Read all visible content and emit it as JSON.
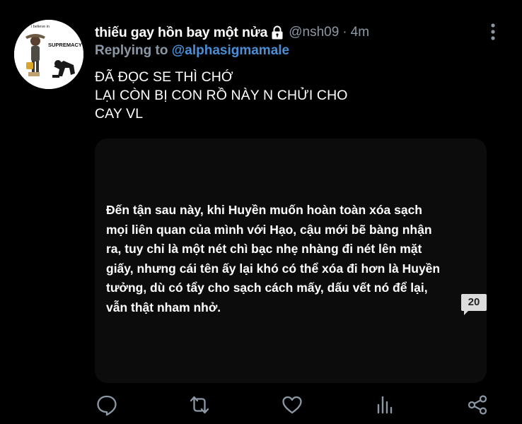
{
  "tweet": {
    "display_name": "thiếu gay hồn bay một nửa",
    "handle": "@nsh09",
    "separator": "·",
    "timestamp": "4m",
    "replying_prefix": "Replying to ",
    "replying_to": "@alphasigmamale",
    "text_lines": [
      "ĐÃ ĐỌC SE THÌ CHỚ",
      "LẠI CÒN BỊ CON RỒ NÀY N CHỬI CHO",
      "CAY VL"
    ]
  },
  "avatar": {
    "caption_small": "i believe in",
    "caption_big": "SUPREMACY"
  },
  "media": {
    "lines": [
      "Đến tận sau này, khi Huyền muốn hoàn toàn xóa sạch",
      "mọi liên quan của mình với Hạo, cậu mới bẽ bàng nhận",
      "ra, tuy chỉ là một nét chì bạc nhẹ nhàng đi nét lên mặt",
      "giấy, nhưng cái tên ấy lại khó có thể xóa đi hơn là Huyền",
      "tưởng, dù có tẩy cho sạch cách mấy, dấu vết nó để lại,",
      "vẫn thật nham nhở."
    ],
    "page_badge": "20"
  },
  "icons": {
    "lock": "lock-icon",
    "more": "more-vertical-icon",
    "reply": "reply-icon",
    "retweet": "retweet-icon",
    "like": "heart-icon",
    "analytics": "analytics-icon",
    "share": "share-icon"
  },
  "colors": {
    "background": "#000000",
    "text": "#ffffff",
    "muted": "#8b98a5",
    "link": "#4a8fd6",
    "card": "#0c0c0d",
    "icon": "#8b98a5"
  }
}
